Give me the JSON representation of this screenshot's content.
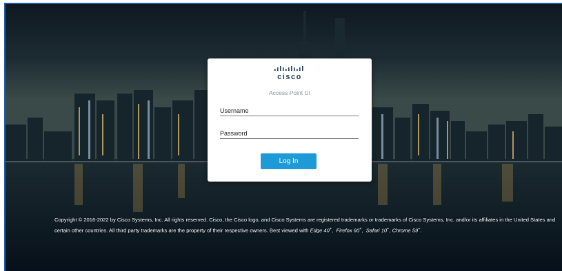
{
  "login": {
    "brand": "cisco",
    "subtitle": "Access Point UI",
    "username_placeholder": "Username",
    "password_placeholder": "Password",
    "login_label": "Log In"
  },
  "footer": {
    "text_1": "Copyright © 2016-2022 by Cisco Systems, Inc. All rights reserved. Cisco, the Cisco logo, and Cisco Systems are registered trademarks or trademarks of Cisco Systems, Inc. and/or its affiliates in the United States and certain other countries. All third party trademarks are the property of their respective owners. Best viewed with ",
    "browser_1": "Edge 40",
    "browser_2": "Firefox 60",
    "browser_3": "Safari 10",
    "browser_4": "Chrome 59",
    "plus": "+"
  },
  "colors": {
    "accent": "#1e9ad6",
    "frame_border": "#1f5fa8",
    "card": "#ffffff"
  },
  "icons": {
    "logo": "cisco-logo-icon"
  }
}
